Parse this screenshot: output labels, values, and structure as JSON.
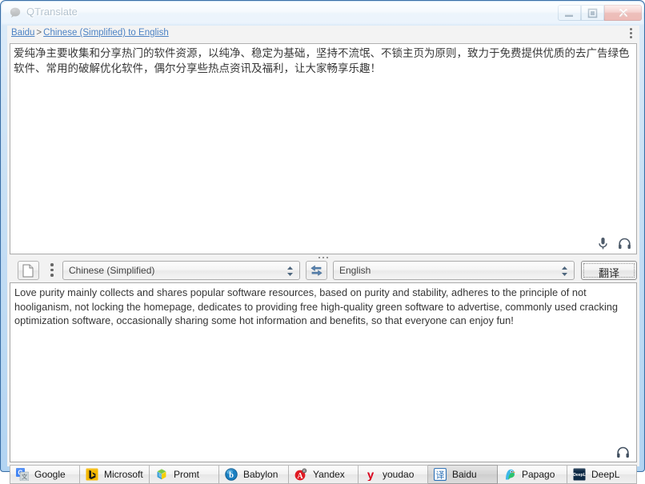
{
  "window": {
    "title": "QTranslate",
    "app_icon": "speech-bubble-icon",
    "controls": {
      "minimize": "Minimize",
      "maximize": "Maximize",
      "close": "Close"
    }
  },
  "breadcrumb": {
    "service": "Baidu",
    "separator": ">",
    "direction": "Chinese (Simplified) to English",
    "menu_icon": "more-vertical-icon"
  },
  "source": {
    "text": "爱纯净主要收集和分享热门的软件资源，以纯净、稳定为基础，坚持不流氓、不锁主页为原则，致力于免费提供优质的去广告绿色软件、常用的破解优化软件，偶尔分享些热点资讯及福利，让大家畅享乐趣！",
    "mic_icon": "microphone-icon",
    "listen_icon": "headphones-icon"
  },
  "toolbar": {
    "file_icon": "document-icon",
    "options_icon": "more-vertical-icon",
    "source_language": "Chinese (Simplified)",
    "swap_icon": "swap-arrows-icon",
    "target_language": "English",
    "translate_label": "翻译"
  },
  "result": {
    "text": "Love purity mainly collects and shares popular software resources, based on purity and stability, adheres to the principle of not hooliganism, not locking the homepage, dedicates to providing free high-quality green software to advertise, commonly used cracking optimization software, occasionally sharing some hot information and benefits, so that everyone can enjoy fun!",
    "listen_icon": "headphones-icon"
  },
  "services": [
    {
      "label": "Google",
      "icon": "google-translate-icon",
      "active": false
    },
    {
      "label": "Microsoft",
      "icon": "bing-icon",
      "active": false
    },
    {
      "label": "Promt",
      "icon": "promt-icon",
      "active": false
    },
    {
      "label": "Babylon",
      "icon": "babylon-icon",
      "active": false
    },
    {
      "label": "Yandex",
      "icon": "yandex-icon",
      "active": false
    },
    {
      "label": "youdao",
      "icon": "youdao-icon",
      "active": false
    },
    {
      "label": "Baidu",
      "icon": "baidu-fanyi-icon",
      "active": true
    },
    {
      "label": "Papago",
      "icon": "papago-parrot-icon",
      "active": false
    },
    {
      "label": "DeepL",
      "icon": "deepl-icon",
      "active": false
    }
  ],
  "colors": {
    "aero_border": "#3a6ea5",
    "link": "#1a5fb4",
    "close_button": "#c5372c",
    "accent_blue": "#2a6fb5"
  }
}
